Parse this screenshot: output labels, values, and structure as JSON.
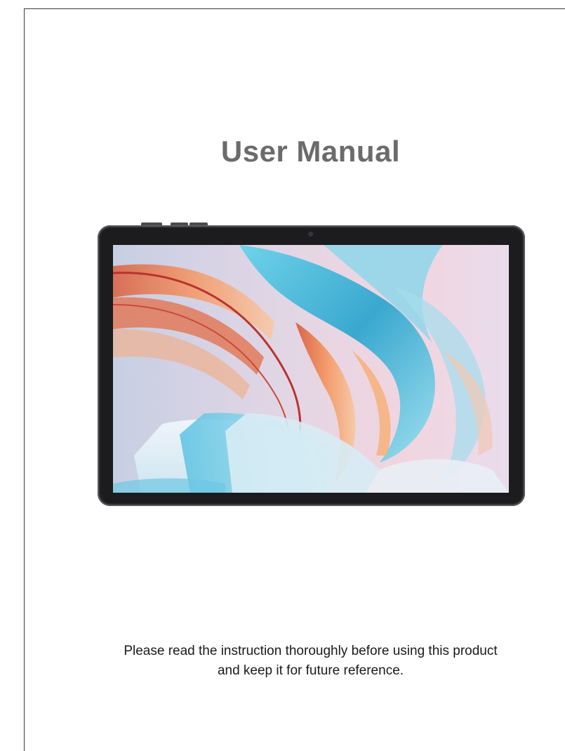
{
  "document": {
    "title": "User Manual",
    "notice_line1": "Please read the instruction thoroughly before using this product",
    "notice_line2": "and keep it for future reference."
  },
  "illustration": {
    "subject": "tablet",
    "colors": {
      "bezel": "#1c1c1e",
      "frame": "#5a5a5e",
      "accent_cyan": "#3fb3d6",
      "accent_orange": "#ef8a5a",
      "accent_red": "#c9443c"
    }
  }
}
